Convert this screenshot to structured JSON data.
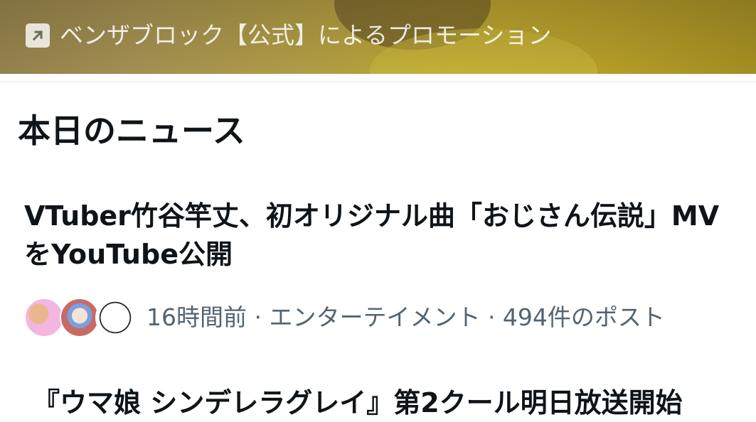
{
  "promo": {
    "label": "ベンザブロック【公式】によるプロモーション",
    "icon": "arrow-up-right-icon"
  },
  "section": {
    "title": "本日のニュース"
  },
  "news": [
    {
      "headline": "VTuber竹谷竿丈、初オリジナル曲「おじさん伝説」MVをYouTube公開",
      "meta": "16時間前 · エンターテイメント · 494件のポスト",
      "avatars": [
        "avatar",
        "avatar",
        "avatar"
      ]
    },
    {
      "headline": "『ウマ娘 シンデレラグレイ』第2クール明日放送開始"
    }
  ],
  "colors": {
    "text_primary": "#0f1419",
    "text_secondary": "#536471",
    "divider": "#eff3f4"
  }
}
